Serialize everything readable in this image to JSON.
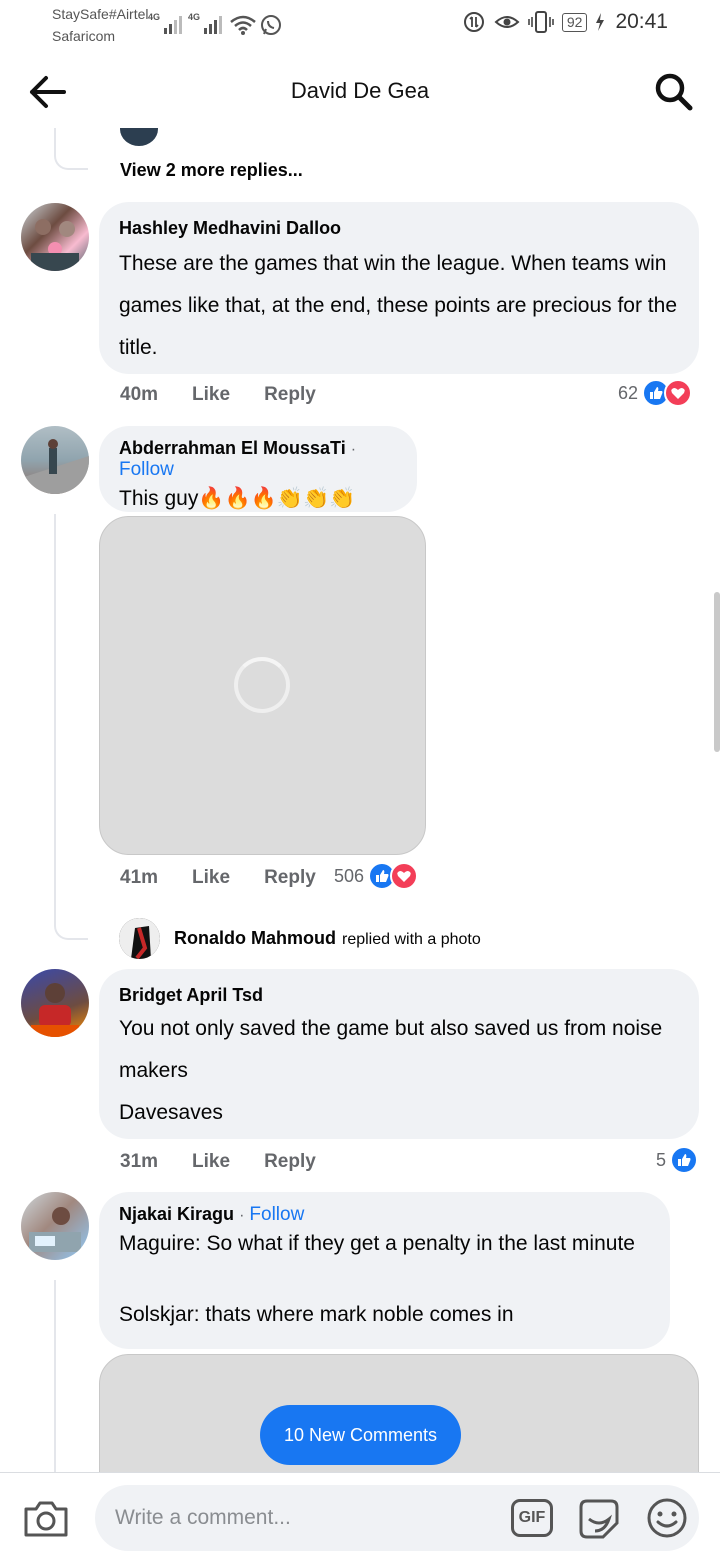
{
  "status_bar": {
    "carrier_primary": "StaySafe#Airtel",
    "carrier_secondary": "Safaricom",
    "network_1": "4G",
    "network_2": "4G",
    "battery": "92",
    "time": "20:41"
  },
  "header": {
    "title": "David De Gea",
    "back_icon": "arrow-left-icon",
    "search_icon": "search-icon"
  },
  "feed": {
    "view_more_replies": "View 2 more replies...",
    "comments": [
      {
        "author": "Hashley Medhavini Dalloo",
        "text": "These are the games that win the league. When teams win games like that, at the end, these points are precious for the title.",
        "time": "40m",
        "like_label": "Like",
        "reply_label": "Reply",
        "reaction_count": "62"
      },
      {
        "author": "Abderrahman El MoussaTi",
        "follow_separator": "·",
        "follow_label": "Follow",
        "text": "This guy🔥🔥🔥👏👏👏",
        "time": "41m",
        "like_label": "Like",
        "reply_label": "Reply",
        "reaction_count": "506",
        "reply_summary": {
          "author": "Ronaldo Mahmoud",
          "description": "replied with a photo"
        }
      },
      {
        "author": "Bridget April Tsd",
        "text_line1": "You not only saved the game but also saved us from noise makers",
        "text_line2": "Davesaves",
        "time": "31m",
        "like_label": "Like",
        "reply_label": "Reply",
        "reaction_count": "5"
      },
      {
        "author": "Njakai Kiragu",
        "follow_separator": "·",
        "follow_label": "Follow",
        "text_line1": "Maguire: So what if they get a penalty in the last minute",
        "text_line2": "Solskjar: thats where mark noble comes in"
      }
    ],
    "new_comments_button": "10 New Comments"
  },
  "composer": {
    "placeholder": "Write a comment...",
    "gif_label": "GIF"
  },
  "colors": {
    "accent": "#1877f2",
    "love": "#f33e58",
    "bubble": "#f0f2f5"
  }
}
